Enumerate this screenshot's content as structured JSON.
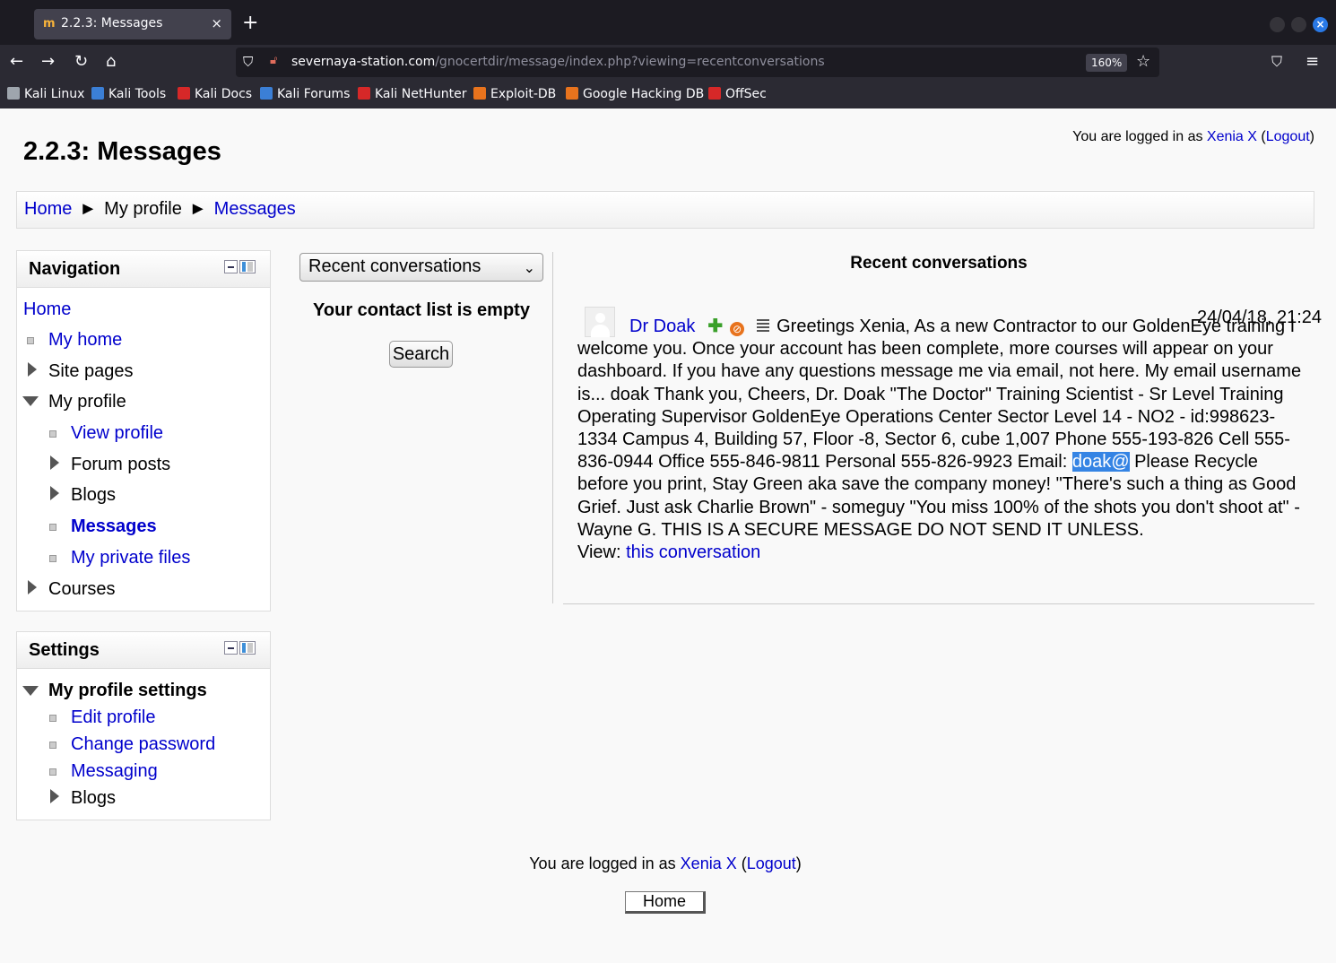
{
  "browser": {
    "tab_title": "2.2.3: Messages",
    "tab_close": "×",
    "new_tab": "+",
    "url_host": "severnaya-station.com",
    "url_path": "/gnocertdir/message/index.php?viewing=recentconversations",
    "zoom": "160%",
    "bookmarks": [
      {
        "label": "Kali Linux",
        "color": "#9ea5ad"
      },
      {
        "label": "Kali Tools",
        "color": "#3b7fd6"
      },
      {
        "label": "Kali Docs",
        "color": "#d62828"
      },
      {
        "label": "Kali Forums",
        "color": "#3b7fd6"
      },
      {
        "label": "Kali NetHunter",
        "color": "#d62828"
      },
      {
        "label": "Exploit-DB",
        "color": "#e8731d"
      },
      {
        "label": "Google Hacking DB",
        "color": "#e8731d"
      },
      {
        "label": "OffSec",
        "color": "#d62828"
      }
    ]
  },
  "page": {
    "title": "2.2.3: Messages",
    "login": {
      "prefix": "You are logged in as ",
      "user": "Xenia X",
      "open": " (",
      "logout": "Logout",
      "close": ")"
    },
    "breadcrumb": {
      "home": "Home",
      "sep": "►",
      "profile": "My profile",
      "messages": "Messages"
    }
  },
  "navigation": {
    "title": "Navigation",
    "home": "Home",
    "my_home": "My home",
    "site_pages": "Site pages",
    "my_profile": "My profile",
    "view_profile": "View profile",
    "forum_posts": "Forum posts",
    "blogs": "Blogs",
    "messages": "Messages",
    "private_files": "My private files",
    "courses": "Courses"
  },
  "settings": {
    "title": "Settings",
    "profile_settings": "My profile settings",
    "edit_profile": "Edit profile",
    "change_password": "Change password",
    "messaging": "Messaging",
    "blogs": "Blogs"
  },
  "contacts": {
    "select_value": "Recent conversations",
    "empty_text": "Your contact list is empty",
    "search_label": "Search"
  },
  "conversation": {
    "heading": "Recent conversations",
    "sender": "Dr Doak",
    "time": "24/04/18, 21:24",
    "message_before": "Greetings Xenia, As a new Contractor to our GoldenEye training I welcome you. Once your account has been complete, more courses will appear on your dashboard. If you have any questions message me via email, not here. My email username is... doak Thank you, Cheers, Dr. Doak \"The Doctor\" Training Scientist - Sr Level Training Operating Supervisor GoldenEye Operations Center Sector Level 14 - NO2 - id:998623-1334 Campus 4, Building 57, Floor -8, Sector 6, cube 1,007 Phone 555-193-826 Cell 555-836-0944 Office 555-846-9811 Personal 555-826-9923 Email: ",
    "message_highlight": "doak@",
    "message_after": " Please Recycle before you print, Stay Green aka save the company money! \"There's such a thing as Good Grief. Just ask Charlie Brown\" - someguy \"You miss 100% of the shots you don't shoot at\" - Wayne G. THIS IS A SECURE MESSAGE DO NOT SEND IT UNLESS.",
    "view_prefix": "View: ",
    "view_link": "this conversation"
  },
  "footer": {
    "login_prefix": "You are logged in as ",
    "user": "Xenia X",
    "open": " (",
    "logout": "Logout",
    "close": ")",
    "home_button": "Home"
  }
}
